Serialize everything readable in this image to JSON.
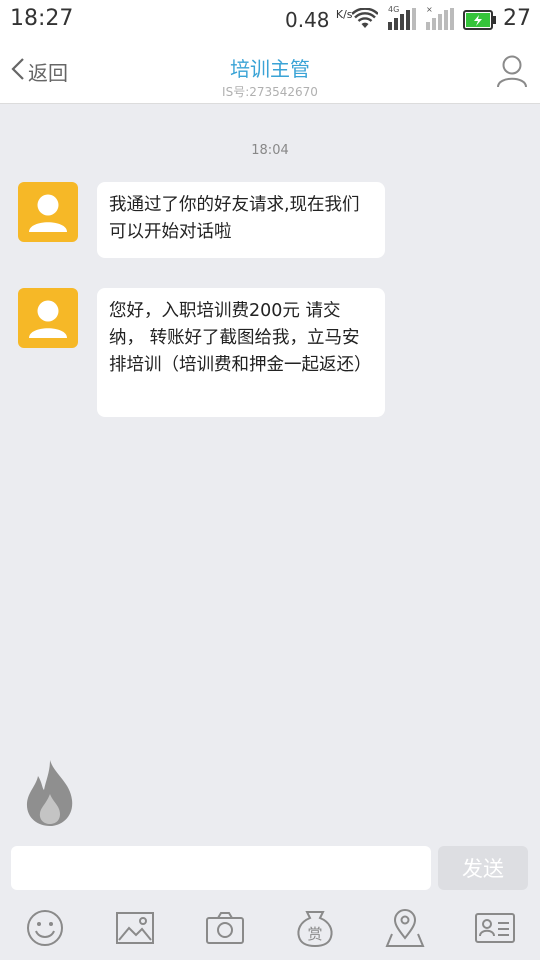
{
  "status_bar": {
    "time": "18:27",
    "network_speed": "0.48",
    "network_speed_unit": "K/s",
    "signal1_label": "4G",
    "signal2_label": "×",
    "battery_level": "27"
  },
  "header": {
    "back_label": "返回",
    "title": "培训主管",
    "subtitle": "IS号:273542670"
  },
  "chat": {
    "timestamp": "18:04",
    "messages": [
      {
        "text": "我通过了你的好友请求,现在我们可以开始对话啦"
      },
      {
        "text": "您好，入职培训费200元 请交纳， 转账好了截图给我，立马安排培训（培训费和押金一起返还）"
      }
    ]
  },
  "input": {
    "value": "",
    "placeholder": "",
    "send_label": "发送"
  },
  "icons": [
    "back-icon",
    "profile-icon",
    "avatar-icon",
    "fire-icon",
    "emoji-icon",
    "image-icon",
    "camera-icon",
    "reward-icon",
    "location-icon",
    "contact-card-icon"
  ],
  "toolbar": {
    "reward_char": "赏"
  },
  "colors": {
    "accent": "#3aa3d6",
    "avatar_bg": "#f6b827",
    "background": "#ebecf0",
    "send_button_bg": "#dddee2",
    "battery_green": "#35c43a"
  }
}
